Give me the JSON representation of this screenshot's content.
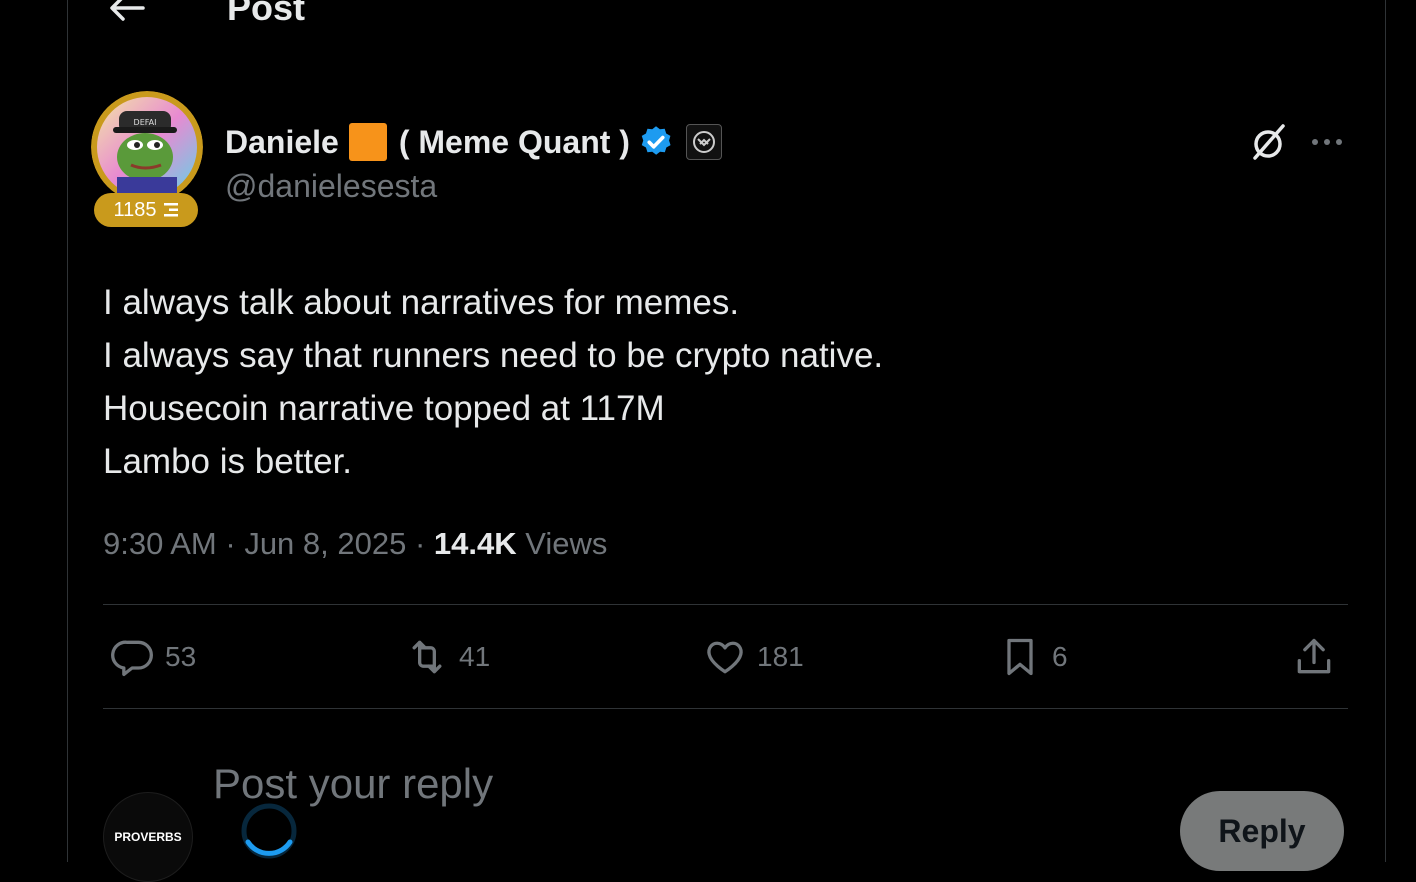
{
  "header": {
    "title": "Post",
    "back_icon": "arrow-left-icon"
  },
  "author": {
    "name": "Daniele",
    "name_suffix": "( Meme Quant )",
    "handle": "@danielesesta",
    "badge_count": "1185",
    "badge_color": "#c99a1c",
    "square_color": "#f7931a",
    "verified_color": "#1d9bf0"
  },
  "tweet": {
    "lines": [
      "I always talk about narratives for memes.",
      "I always say that runners need to be crypto native.",
      "Housecoin narrative topped at 117M",
      "Lambo is better."
    ]
  },
  "meta": {
    "time": "9:30 AM",
    "date": "Jun 8, 2025",
    "views_count": "14.4K",
    "views_label": "Views"
  },
  "actions": {
    "replies": "53",
    "reposts": "41",
    "likes": "181",
    "bookmarks": "6"
  },
  "reply": {
    "placeholder": "Post your reply",
    "button_label": "Reply",
    "avatar_text": "PROVERBS"
  },
  "colors": {
    "background": "#000000",
    "text": "#e7e9ea",
    "muted": "#71767b",
    "border": "#2f3336"
  }
}
